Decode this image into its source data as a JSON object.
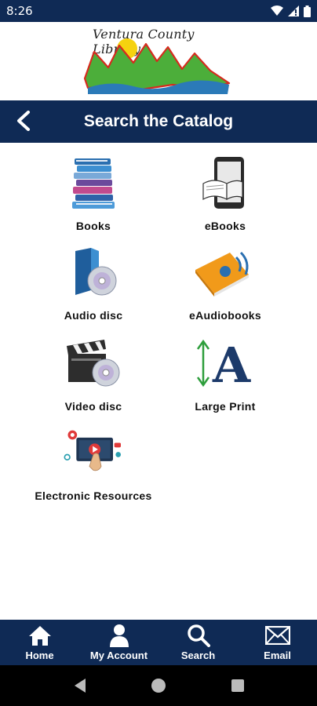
{
  "status_bar": {
    "time": "8:26"
  },
  "header": {
    "logo_text": "Ventura County Library",
    "title": "Search the Catalog"
  },
  "catalog": [
    {
      "label": "Books",
      "icon": "books-icon"
    },
    {
      "label": "eBooks",
      "icon": "ebook-reader-icon"
    },
    {
      "label": "Audio disc",
      "icon": "audio-disc-icon"
    },
    {
      "label": "eAudiobooks",
      "icon": "eaudiobook-icon"
    },
    {
      "label": "Video disc",
      "icon": "video-disc-icon"
    },
    {
      "label": "Large Print",
      "icon": "large-print-icon"
    },
    {
      "label": "Electronic Resources",
      "icon": "electronic-resources-icon"
    }
  ],
  "bottom_nav": [
    {
      "label": "Home",
      "icon": "home-icon"
    },
    {
      "label": "My Account",
      "icon": "account-icon"
    },
    {
      "label": "Search",
      "icon": "search-icon"
    },
    {
      "label": "Email",
      "icon": "email-icon"
    }
  ],
  "colors": {
    "navy": "#0f2a55",
    "white": "#ffffff"
  }
}
